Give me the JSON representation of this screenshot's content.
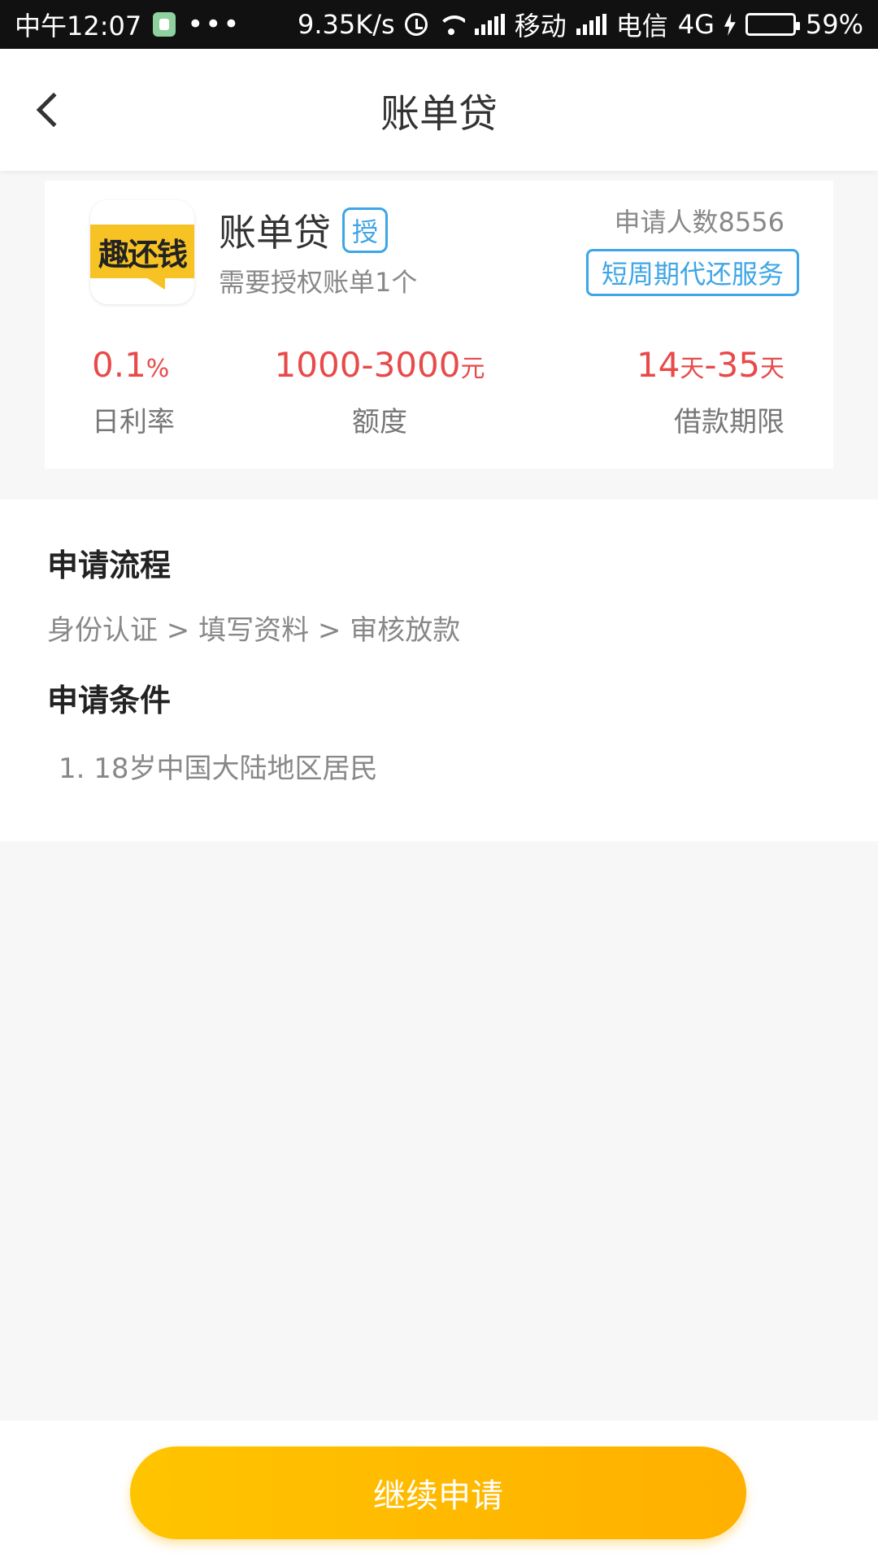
{
  "status_bar": {
    "time": "中午12:07",
    "dots": "•••",
    "speed": "9.35K/s",
    "carrier1": "移动",
    "carrier2": "电信",
    "network": "4G",
    "battery": "59%",
    "battery_level": 0.59
  },
  "header": {
    "title": "账单贷"
  },
  "product": {
    "logo_text": "趣还钱",
    "name": "账单贷",
    "auth_badge": "授",
    "subtitle": "需要授权账单1个",
    "applicants": "申请人数8556",
    "service_tag": "短周期代还服务",
    "stats": {
      "rate_value": "0.1",
      "rate_unit": "%",
      "rate_label": "日利率",
      "amount_value": "1000-3000",
      "amount_unit": "元",
      "amount_label": "额度",
      "term_value_1": "14",
      "term_unit_1": "天",
      "term_value_2": "-35",
      "term_unit_2": "天",
      "term_label": "借款期限"
    }
  },
  "info": {
    "process_title": "申请流程",
    "process_steps": "身份认证 > 填写资料 > 审核放款",
    "conditions_title": "申请条件",
    "conditions": [
      "1. 18岁中国大陆地区居民"
    ]
  },
  "footer": {
    "apply_label": "继续申请"
  },
  "colors": {
    "accent_blue": "#3ea5e6",
    "value_red": "#e84a4a",
    "button_yellow": "#ffc400"
  }
}
